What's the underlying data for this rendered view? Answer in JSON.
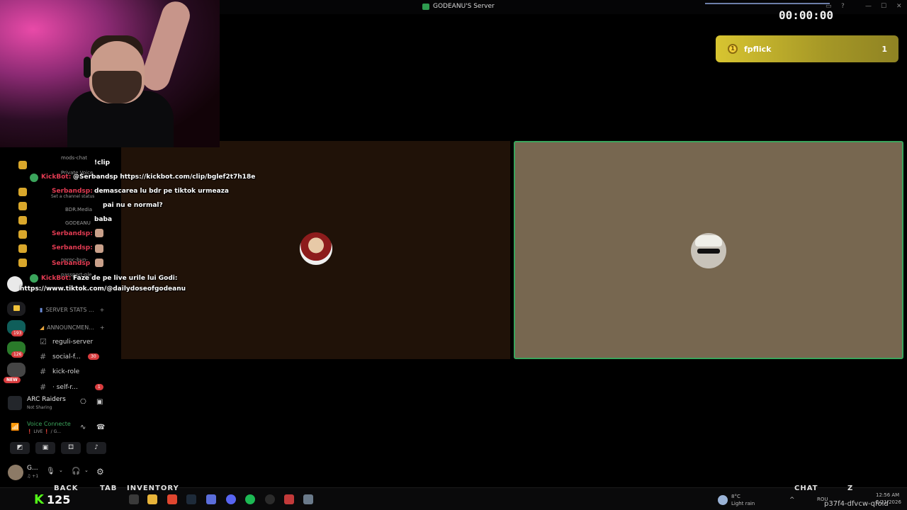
{
  "window": {
    "title": "GODEANU'S Server"
  },
  "stream": {
    "timer": "00:00:00",
    "goal": {
      "name": "fpflick",
      "count": "1"
    },
    "chat_lines": [
      {
        "user": "",
        "text": "!clip"
      },
      {
        "user": "KickBot:",
        "text": "@Serbandsp https://kickbot.com/clip/bglef2t7h18e"
      },
      {
        "user": "Serbandsp:",
        "text": "demascarea lu bdr pe tiktok urmeaza"
      },
      {
        "user": "",
        "text": "pai nu e normal?"
      },
      {
        "user": "",
        "text": "baba"
      },
      {
        "user": "Serbandsp:",
        "text": ""
      },
      {
        "user": "Serbandsp:",
        "text": ""
      },
      {
        "user": "Serbandsp",
        "text": ""
      },
      {
        "user": "KickBot:",
        "text": "Faze de pe live urile lui Godi:"
      },
      {
        "user": "",
        "text": "https://www.tiktok.com/@dailydoseofgodeanu"
      }
    ],
    "kick_followers": "125",
    "watermark": "p37f4-dfvcw-qfold"
  },
  "discord": {
    "faint_items": [
      "mods-chat",
      "Private Voice",
      "Set a channel status",
      "BDR.Media",
      "GODEANU",
      "noroc-bun-",
      "passport-ple"
    ],
    "categories": [
      {
        "label": "SERVER STATS ..."
      },
      {
        "label": "ANNOUNCMEN..."
      }
    ],
    "channels": [
      {
        "label": "reguli-server",
        "badge": ""
      },
      {
        "label": "social-f...",
        "badge": "30"
      },
      {
        "label": "kick-role",
        "badge": ""
      },
      {
        "label": "· self-r...",
        "badge": "1"
      }
    ],
    "rail_badges": [
      "193",
      "126"
    ],
    "new_badge": "NEW",
    "activity": {
      "title": "ARC Raiders",
      "subtitle": "Not Sharing"
    },
    "voice": {
      "title": "Voice Connecte",
      "subtitle": "❗ LIVE ❗ / G..."
    },
    "user": {
      "name": "G...",
      "status": "♫ +1"
    }
  },
  "taskbar": {
    "weather_temp": "8°C",
    "weather_desc": "Light rain",
    "lang": "ROU",
    "time": "12:56 AM",
    "date": "2/21/2026",
    "hud_back": "BACK",
    "hud_tab": "TAB",
    "hud_inventory": "INVENTORY",
    "hud_chat": "CHAT",
    "hud_z": "Z"
  },
  "colors": {
    "goal_gold": "#d8c531",
    "speaking_border": "#3aa55c",
    "kick_green": "#53fc18",
    "badge_red": "#d83c3e",
    "chat_user": "#e23b52"
  }
}
